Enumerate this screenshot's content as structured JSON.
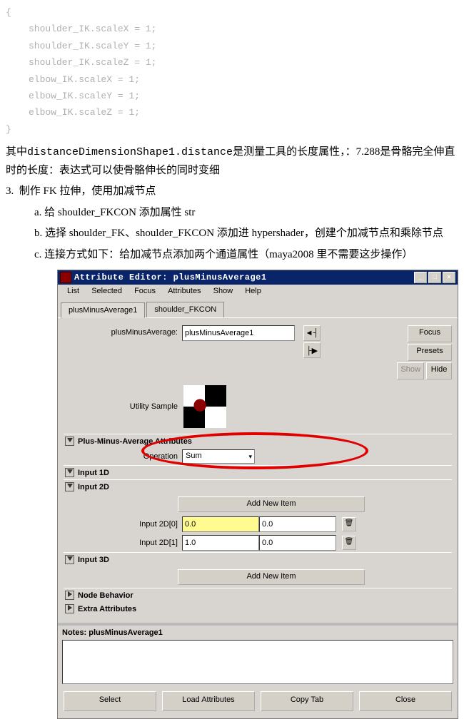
{
  "code": {
    "brace_open": "{",
    "l1": "shoulder_IK.scaleX = 1;",
    "l2": "shoulder_IK.scaleY = 1;",
    "l3": "shoulder_IK.scaleZ = 1;",
    "l4": "elbow_IK.scaleX = 1;",
    "l5": "elbow_IK.scaleY = 1;",
    "l6": "elbow_IK.scaleZ = 1;",
    "brace_close": "}"
  },
  "para1_a": "其中",
  "para1_b": "distanceDimensionShape1.distance",
  "para1_c": "是测量工具的长度属性，：7.288是骨骼完全伸直时的长度：表达式可以使骨骼伸长的同时变细",
  "list_num": "3.",
  "list_num_text": "制作 FK 拉伸，使用加减节点",
  "li_a": "a.  给 shoulder_FKCON 添加属性 str",
  "li_b": "b.  选择 shoulder_FK、shoulder_FKCON 添加进 hypershader，创建个加减节点和乘除节点",
  "li_c": "c.  连接方式如下：给加减节点添加两个通道属性（maya2008 里不需要这步操作）",
  "window": {
    "title": "Attribute Editor: plusMinusAverage1",
    "menu": {
      "list": "List",
      "selected": "Selected",
      "focus": "Focus",
      "attributes": "Attributes",
      "show": "Show",
      "help": "Help"
    },
    "tabs": {
      "t1": "plusMinusAverage1",
      "t2": "shoulder_FKCON"
    },
    "attr_label": "plusMinusAverage:",
    "attr_value": "plusMinusAverage1",
    "btn_focus": "Focus",
    "btn_presets": "Presets",
    "btn_show": "Show",
    "btn_hide": "Hide",
    "sample_label": "Utility Sample",
    "section_pma": "Plus-Minus-Average Attributes",
    "op_label": "Operation",
    "op_value": "Sum",
    "section_1d": "Input 1D",
    "section_2d": "Input 2D",
    "add_item": "Add New Item",
    "in2d0_label": "Input 2D[0]",
    "in2d0_a": "0.0",
    "in2d0_b": "0.0",
    "in2d1_label": "Input 2D[1]",
    "in2d1_a": "1.0",
    "in2d1_b": "0.0",
    "section_3d": "Input 3D",
    "section_nb": "Node Behavior",
    "section_ea": "Extra Attributes",
    "notes": "Notes: plusMinusAverage1",
    "b_select": "Select",
    "b_load": "Load Attributes",
    "b_copy": "Copy Tab",
    "b_close": "Close"
  }
}
